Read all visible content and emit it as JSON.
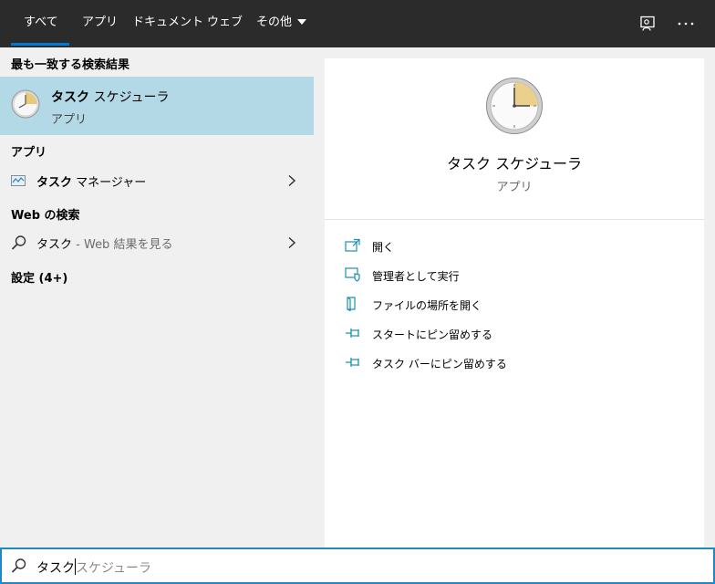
{
  "tabs": [
    {
      "label": "すべて",
      "active": true
    },
    {
      "label": "アプリ"
    },
    {
      "label": "ドキュメント"
    },
    {
      "label": "ウェブ"
    },
    {
      "label": "その他"
    }
  ],
  "top_icons": [
    "feedback-icon",
    "more-options-icon"
  ],
  "left": {
    "best_match_header": "最も一致する検索結果",
    "best_match": {
      "title_bold": "タスク",
      "title_rest": " スケジューラ",
      "subtitle": "アプリ",
      "icon": "clock-icon"
    },
    "apps_header": "アプリ",
    "apps": [
      {
        "label_bold": "タスク",
        "label_rest": " マネージャー",
        "icon": "task-manager-icon"
      }
    ],
    "web_header": "Web の検索",
    "web": [
      {
        "label": "タスク",
        "hint": " - Web 結果を見る",
        "icon": "search-icon"
      }
    ],
    "settings_header": "設定 (4+)"
  },
  "right": {
    "title": "タスク スケジューラ",
    "subtitle": "アプリ",
    "actions": [
      {
        "label": "開く",
        "icon": "open-icon"
      },
      {
        "label": "管理者として実行",
        "icon": "run-as-admin-icon"
      },
      {
        "label": "ファイルの場所を開く",
        "icon": "file-location-icon"
      },
      {
        "label": "スタートにピン留めする",
        "icon": "pin-start-icon"
      },
      {
        "label": "タスク バーにピン留めする",
        "icon": "pin-taskbar-icon"
      }
    ]
  },
  "search": {
    "typed": "タスク",
    "suggestion": "スケジューラ"
  },
  "colors": {
    "accent": "#0078d7",
    "selection": "#b3d9e6",
    "topbar": "#2b2b2b",
    "icon_teal": "#1b8fb0"
  }
}
